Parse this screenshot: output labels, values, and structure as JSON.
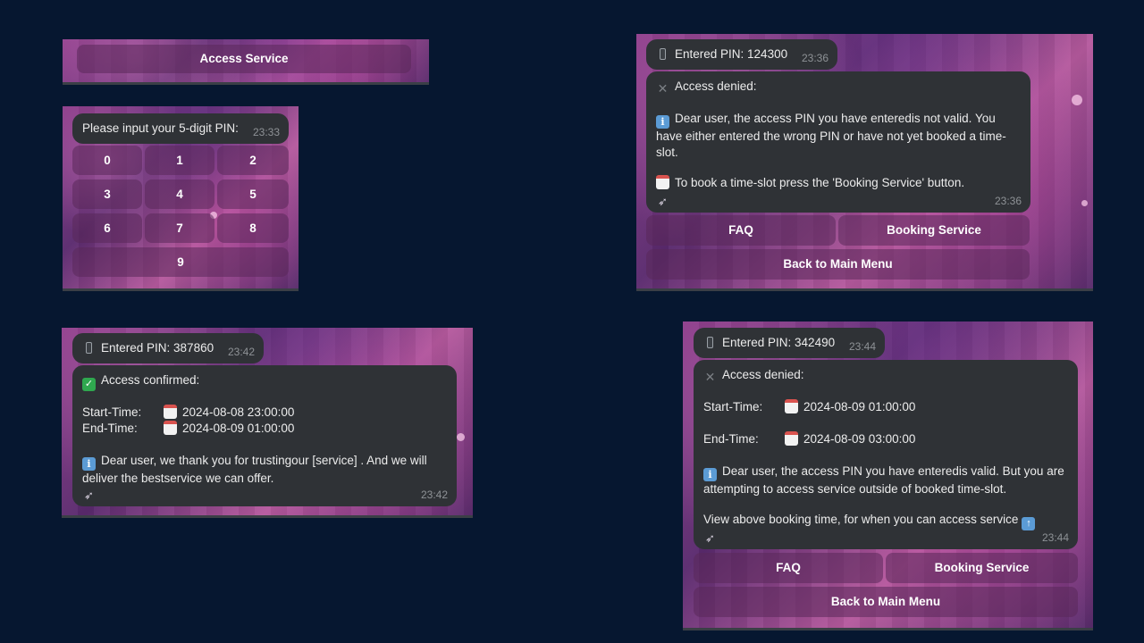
{
  "panel1": {
    "button": "Access Service"
  },
  "panel2": {
    "prompt": "Please input your 5-digit PIN:",
    "time": "23:33",
    "keys": [
      "0",
      "1",
      "2",
      "3",
      "4",
      "5",
      "6",
      "7",
      "8",
      "9"
    ]
  },
  "panel3": {
    "pin_msg": "Entered PIN: 124300",
    "pin_time": "23:36",
    "status": "Access denied:",
    "info": "Dear user, the access PIN you have enteredis not valid. You have either entered the wrong PIN or have not yet booked a time-slot.",
    "book": "To book a time-slot press the 'Booking Service' button.",
    "time": "23:36",
    "btn_faq": "FAQ",
    "btn_booking": "Booking Service",
    "btn_back": "Back to Main Menu"
  },
  "panel4": {
    "pin_msg": "Entered PIN: 387860",
    "pin_time": "23:42",
    "status": "Access confirmed:",
    "start_label": "Start-Time:",
    "start_value": "2024-08-08 23:00:00",
    "end_label": "End-Time:",
    "end_value": "2024-08-09 01:00:00",
    "info": "Dear user, we thank you for trustingour [service] . And we will deliver the bestservice we can offer.",
    "time": "23:42"
  },
  "panel5": {
    "pin_msg": "Entered PIN: 342490",
    "pin_time": "23:44",
    "status": "Access denied:",
    "start_label": "Start-Time:",
    "start_value": "2024-08-09 01:00:00",
    "end_label": "End-Time:",
    "end_value": "2024-08-09 03:00:00",
    "info": "Dear user, the access PIN you have enteredis valid. But you are attempting to access service outside of booked time-slot.",
    "view": "View above booking time, for when you can access service",
    "time": "23:44",
    "btn_faq": "FAQ",
    "btn_booking": "Booking Service",
    "btn_back": "Back to Main Menu"
  },
  "icons": {
    "phone": "mobile-phone-icon",
    "cross": "cross-mark-icon",
    "check": "check-mark-icon",
    "info": "information-icon",
    "calendar": "calendar-icon",
    "rocket": "rocket-icon",
    "up": "up-arrow-icon"
  }
}
